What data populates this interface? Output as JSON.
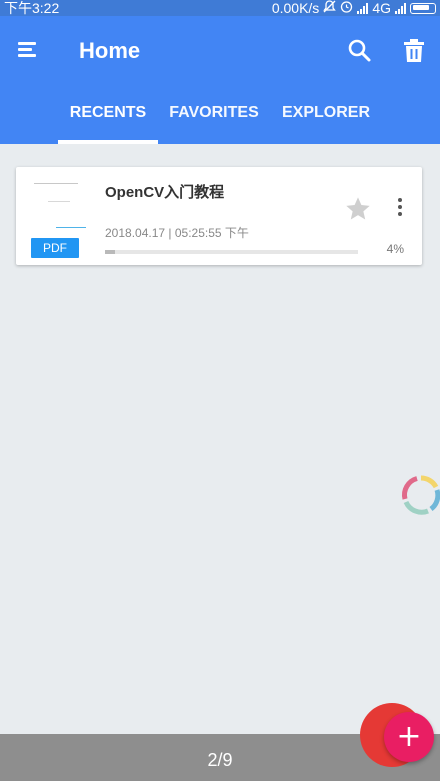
{
  "status_bar": {
    "time": "下午3:22",
    "net_speed": "0.00K/s",
    "network": "4G"
  },
  "app_bar": {
    "title": "Home",
    "icons": [
      "menu-icon",
      "search-icon",
      "trash-icon"
    ],
    "color": "#4285f4"
  },
  "tabs": [
    {
      "label": "RECENTS",
      "active": true
    },
    {
      "label": "FAVORITES",
      "active": false
    },
    {
      "label": "EXPLORER",
      "active": false
    }
  ],
  "recent_files": [
    {
      "name": "OpenCV入门教程",
      "type_badge": "PDF",
      "date": "2018.04.17 | 05:25:55 下午",
      "progress_percent": 4,
      "progress_label": "4%",
      "favorite": false
    }
  ],
  "bottom_bar": {
    "page_indicator": "2/9"
  },
  "fab": {
    "label": "+",
    "color": "#e91e63"
  }
}
